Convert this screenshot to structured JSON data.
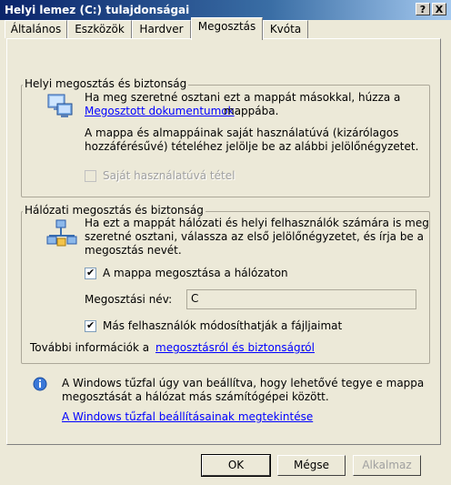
{
  "window": {
    "title": "Helyi lemez (C:) tulajdonságai",
    "help_btn": "?",
    "close_btn": "X"
  },
  "tabs": [
    {
      "label": "Általános"
    },
    {
      "label": "Eszközök"
    },
    {
      "label": "Hardver"
    },
    {
      "label": "Megosztás"
    },
    {
      "label": "Kvóta"
    }
  ],
  "local_group": {
    "title": "Helyi megosztás és biztonság",
    "line1": "Ha meg szeretné osztani ezt a mappát másokkal, húzza a",
    "link": "Megosztott dokumentumok",
    "line2_suffix": "mappába.",
    "para2_line1": "A mappa és almappáinak saját használatúvá (kizárólagos",
    "para2_line2": "hozzáférésűvé) tételéhez jelölje be az alábbi jelölőnégyzetet.",
    "private_checkbox_label": "Saját használatúvá tétel",
    "private_checked": false
  },
  "network_group": {
    "title": "Hálózati megosztás és biztonság",
    "para_line1": "Ha ezt a mappát hálózati és helyi felhasználók számára is meg",
    "para_line2": "szeretné osztani, válassza az első jelölőnégyzetet, és írja be a",
    "para_line3": "megosztás nevét.",
    "share_checkbox_label": "A mappa megosztása a hálózaton",
    "share_checked": true,
    "share_name_label": "Megosztási név:",
    "share_name_value": "C",
    "allow_change_label": "Más felhasználók módosíthatják a fájljaimat",
    "allow_change_checked": true,
    "more_info_prefix": "További információk a",
    "more_info_link": "megosztásról és biztonságról",
    "more_info_suffix": "."
  },
  "firewall": {
    "line1": "A Windows tűzfal úgy van beállítva, hogy lehetővé tegye e mappa",
    "line2": "megosztását a hálózat más számítógépei között.",
    "link": "A Windows tűzfal beállításainak megtekintése"
  },
  "buttons": {
    "ok": "OK",
    "cancel": "Mégse",
    "apply": "Alkalmaz"
  }
}
